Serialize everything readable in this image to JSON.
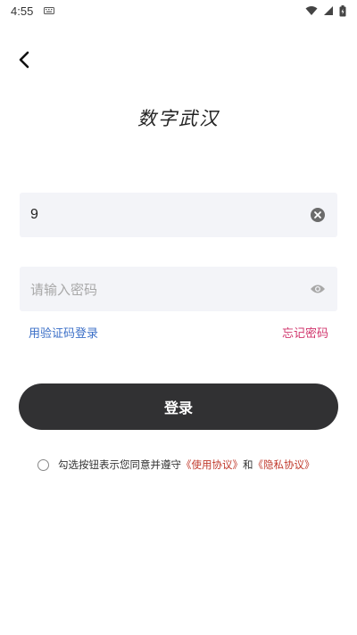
{
  "status_bar": {
    "time": "4:55"
  },
  "header": {
    "back_icon": "chevron-left-icon",
    "title": "数字武汉"
  },
  "form": {
    "phone": {
      "value": "9",
      "clear_icon": "clear-circle-icon"
    },
    "password": {
      "value": "",
      "placeholder": "请输入密码",
      "visibility_icon": "eye-icon"
    },
    "sms_login_label": "用验证码登录",
    "forgot_password_label": "忘记密码",
    "login_label": "登录"
  },
  "agreement": {
    "text_before": "勾选按钮表示您同意并遵守",
    "terms_link": "《使用协议》",
    "and": "和",
    "privacy_link": "《隐私协议》",
    "checked": false
  },
  "colors": {
    "login_button_bg": "#313133",
    "sms_link": "#3b6fc7",
    "forgot_link": "#d1356c",
    "agreement_link": "#c0392b",
    "input_bg": "#f3f4f8"
  }
}
